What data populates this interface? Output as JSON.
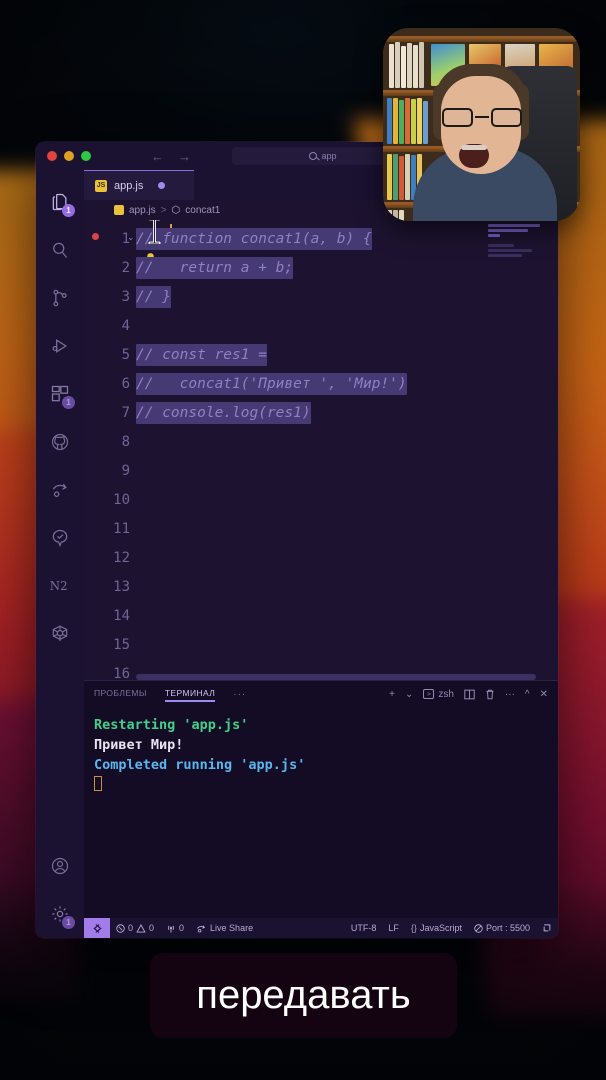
{
  "window": {
    "traffic_lights": [
      "close",
      "minimize",
      "maximize"
    ],
    "search": {
      "value": "app",
      "icon": "search-icon"
    },
    "nav": {
      "back": "←",
      "forward": "→"
    }
  },
  "activitybar": {
    "items": [
      {
        "name": "explorer",
        "icon": "files-icon",
        "badge": "1",
        "active": true
      },
      {
        "name": "search",
        "icon": "search-icon",
        "badge": ""
      },
      {
        "name": "source-control",
        "icon": "source-control-icon",
        "badge": ""
      },
      {
        "name": "run-and-debug",
        "icon": "debug-icon",
        "badge": ""
      },
      {
        "name": "extensions",
        "icon": "extensions-icon",
        "badge": "1"
      },
      {
        "name": "github",
        "icon": "github-icon",
        "badge": ""
      },
      {
        "name": "live-share",
        "icon": "live-share-icon",
        "badge": ""
      },
      {
        "name": "testing",
        "icon": "testing-icon",
        "badge": ""
      },
      {
        "name": "notebook",
        "icon": "n2-icon",
        "badge": ""
      },
      {
        "name": "kubernetes",
        "icon": "kubernetes-icon",
        "badge": ""
      }
    ],
    "bottom": [
      {
        "name": "account",
        "icon": "account-icon",
        "badge": ""
      },
      {
        "name": "settings",
        "icon": "gear-icon",
        "badge": "1"
      }
    ]
  },
  "tabs": [
    {
      "label": "app.js",
      "icon": "js-file-icon",
      "dirty": true,
      "active": true
    }
  ],
  "breadcrumb": {
    "file": "app.js",
    "separator": ">",
    "symbol": "concat1",
    "symbol_icon": "symbol-method-icon",
    "file_icon": "js-file-icon"
  },
  "editor": {
    "language": "JavaScript",
    "cursor_line": 1,
    "breakpoint_line": 1,
    "lightbulb_line": 2,
    "line_numbers": [
      "1",
      "2",
      "3",
      "4",
      "5",
      "6",
      "7",
      "8",
      "9",
      "10",
      "11",
      "12",
      "13",
      "14",
      "15",
      "16"
    ],
    "lines": [
      "// function concat1(a, b) {",
      "//   return a + b;",
      "// }",
      "",
      "// const res1 =",
      "//   concat1('Привет ', 'Мир!')",
      "// console.log(res1)",
      "",
      "",
      "",
      "",
      "",
      "",
      "",
      "",
      ""
    ]
  },
  "panel": {
    "tabs": [
      {
        "label": "ПРОБЛЕМЫ",
        "active": false
      },
      {
        "label": "ТЕРМИНАЛ",
        "active": true
      }
    ],
    "overflow": "···",
    "tools": {
      "add": "+",
      "add_chevron": "⌄",
      "shell": "zsh",
      "shell_icon": "terminal-icon",
      "split": "split-icon",
      "kill": "trash-icon",
      "more": "···",
      "collapse": "^",
      "close": "✕"
    },
    "terminal_lines": [
      {
        "text": "Restarting 'app.js'",
        "color": "green"
      },
      {
        "text": "Привет Мир!",
        "color": "white"
      },
      {
        "text": "Completed running 'app.js'",
        "color": "blue"
      }
    ]
  },
  "statusbar": {
    "remote_icon": "remote-icon",
    "errors": "0",
    "warnings": "0",
    "ports": "0",
    "live_share": "Live Share",
    "encoding": "UTF-8",
    "eol": "LF",
    "language": "JavaScript",
    "port": "Port : 5500",
    "notifications_icon": "bell-icon",
    "error_icon": "error-icon",
    "warning_icon": "warning-icon",
    "radio_icon": "radio-tower-icon",
    "broadcast_icon": "broadcast-icon",
    "braces_icon": "braces-icon",
    "circle_slash_icon": "circle-slash-icon"
  },
  "webcam": {
    "label": "webcam-overlay"
  },
  "caption": {
    "text": "передавать"
  },
  "colors": {
    "accent": "#9b8cf0",
    "tab_active_border": "#8a6bd8",
    "editor_bg": "#1d1330",
    "panel_bg": "#140c24",
    "terminal_green": "#3fd18b",
    "terminal_blue": "#58b6f0",
    "badge": "#9b6ff0",
    "breakpoint": "#d6434b"
  }
}
